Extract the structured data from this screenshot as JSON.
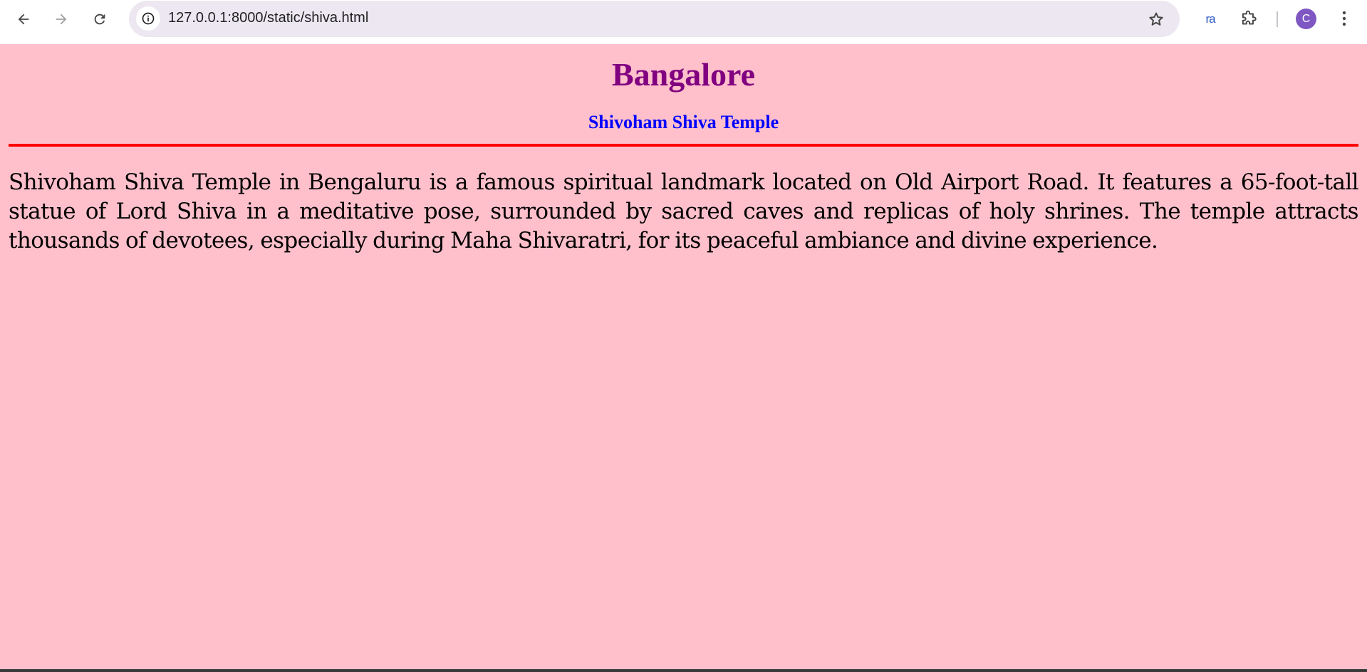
{
  "browser": {
    "url": "127.0.0.1:8000/static/shiva.html",
    "extension_label": "ra",
    "profile_initial": "C",
    "profile_color": "#7e57c2"
  },
  "page": {
    "heading": "Bangalore",
    "subheading": "Shivoham Shiva Temple",
    "paragraph": "Shivoham Shiva Temple in Bengaluru is a famous spiritual landmark located on Old Airport Road. It features a 65-foot-tall statue of Lord Shiva in a meditative pose, surrounded by sacred caves and replicas of holy shrines. The temple attracts thousands of devotees, especially during Maha Shivaratri, for its peaceful ambiance and divine experience.",
    "colors": {
      "background": "#ffc0cb",
      "heading": "#800080",
      "subheading": "#0000ff",
      "divider": "#ff0000"
    }
  },
  "icons": {
    "back": "back-arrow-icon",
    "forward": "forward-arrow-icon",
    "reload": "reload-icon",
    "site_info": "info-icon",
    "bookmark": "star-icon",
    "extensions": "puzzle-icon",
    "menu": "kebab-menu-icon"
  }
}
